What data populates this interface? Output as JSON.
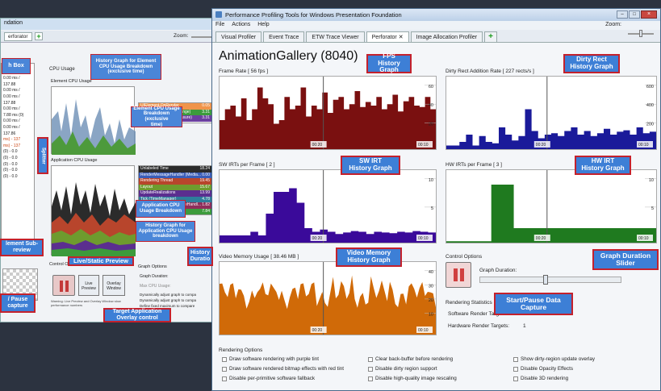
{
  "back_window": {
    "title": "ndation",
    "tab_label": "erforator",
    "zoom_label": "Zoom:",
    "cpu_usage_label": "CPU Usage",
    "element_cpu_label": "Element CPU Usage",
    "element_legend": [
      {
        "label": "UIElement.OnRender",
        "value": "0.05",
        "color": "#f0944a"
      },
      {
        "label": "UIElement Layout (Arrange)",
        "value": "3.31",
        "color": "#3c9b3c"
      },
      {
        "label": "UIElement Layout (Measure)",
        "value": "3.31",
        "color": "#6b3fa0"
      }
    ],
    "app_cpu_label": "Application CPU Usage",
    "app_legend": [
      {
        "label": "Unlabeled Time",
        "value": "18.24",
        "color": "#2b2b2b"
      },
      {
        "label": "RenderMessageHandler (Media...",
        "value": "0.00",
        "color": "#3a5db8"
      },
      {
        "label": "Rendering Thread",
        "value": "19.45",
        "color": "#b8452c"
      },
      {
        "label": "Layout",
        "value": "15.67",
        "color": "#6e9b2e"
      },
      {
        "label": "UpdateRealizations",
        "value": "13.99",
        "color": "#5b2e8f"
      },
      {
        "label": "Tick (TimeManager)",
        "value": "4.78",
        "color": "#2e7d9b"
      },
      {
        "label": "AnimatedRenderMessageHandl...",
        "value": "1.82",
        "color": "#8f2e5b"
      },
      {
        "label": "Render (MediaContext)",
        "value": "7.84",
        "color": "#3c9b3c"
      }
    ],
    "left_list": [
      "0.00 ms",
      "137.88 ms",
      "0.00 ms /",
      "137.88",
      "0.00 ms /",
      "0.00 ms /",
      "137.88",
      "0.00 ms /",
      "7.88 ms (0)",
      "0.00 ms /",
      "0.00 ms /",
      "137.86",
      "ms) - 137",
      "ms) - 137",
      "(0) - 0.0",
      "(0) - 0.0",
      "(0) - 0.0",
      "(0) - 0.0",
      "(0) - 0.0"
    ],
    "control_options": "Control Opt",
    "live_preview_btn": "Live Preview",
    "overlay_window_btn": "Overlay Window",
    "warning_text": "Warning: Live Preview and Overlay Window slow performance numbers",
    "graph_options": "Graph Options",
    "graph_duration": "Graph Duration:",
    "max_cpu": "Max CPU Usage:",
    "radio1": "Dynamically adjust graph to compa",
    "radio2": "Dynamically adjust graph to compa",
    "radio3": "Define fixed maximum to compare"
  },
  "callouts": {
    "search_box": "h Box",
    "history_graph_element": "History Graph for Element\nCPU Usage Breakdown\n(exclusive time)",
    "element_breakdown": "Element CPU Usage\nBreakdown (exclusive\ntime)",
    "splitter": "Splitter",
    "app_cpu_breakdown": "Application CPU\nUsage Breakdown",
    "history_graph_app": "History Graph for\nApplication CPU Usage\nbreakdown",
    "element_sub_preview": "lement Sub-\nreview",
    "live_static": "Live/Static Preview",
    "pause_capture": "/ Pause\ncapture",
    "history_duration": "History\nDuratio",
    "target_app": "Target Application\nOverlay control",
    "fps": "FPS\nHistory Graph",
    "dirty_rect": "Dirty Rect\nHistory Graph",
    "sw_irt": "SW IRT\nHistory Graph",
    "hw_irt": "HW IRT\nHistory Graph",
    "video_memory": "Video Memory\nHistory Graph",
    "graph_duration_slider": "Graph Duration\nSlider",
    "start_pause": "Start/Pause Data\nCapture"
  },
  "main_window": {
    "title": "Performance Profiling Tools for Windows Presentation Foundation",
    "menu": [
      "File",
      "Actions",
      "Help"
    ],
    "zoom_label": "Zoom:",
    "tabs": [
      "Visual Profiler",
      "Event Trace",
      "ETW Trace Viewer",
      "Perforator",
      "Image Allocation Profiler"
    ],
    "active_tab": "Perforator",
    "app_title": "AnimationGallery (8040)",
    "graphs": {
      "frame_rate": {
        "title": "Frame Rate [ 56 fps ]",
        "y_ticks": [
          "60",
          "40",
          "20"
        ],
        "x_ticks": [
          "00:20",
          "00:10"
        ],
        "color": "#7a1010"
      },
      "dirty_rect": {
        "title": "Dirty Rect Addition Rate [ 227 rects/s ]",
        "y_ticks": [
          "600",
          "400",
          "200"
        ],
        "x_ticks": [
          "00:20",
          "00:10"
        ],
        "color": "#1a1a9a"
      },
      "sw_irt": {
        "title": "SW IRTs per Frame [ 2 ]",
        "y_ticks": [
          "10",
          "5"
        ],
        "x_ticks": [
          "00:20",
          "00:10"
        ],
        "color": "#3a0a9a"
      },
      "hw_irt": {
        "title": "HW IRTs per Frame [ 3 ]",
        "y_ticks": [
          "10",
          "5"
        ],
        "x_ticks": [
          "00:20",
          "00:10"
        ],
        "color": "#1f7a1f"
      },
      "video_memory": {
        "title": "Video Memory Usage [ 38.46 MB ]",
        "y_ticks": [
          "40",
          "30",
          "20",
          "10"
        ],
        "x_ticks": [
          "00:20",
          "00:10"
        ],
        "color": "#d06a08"
      }
    },
    "control_options": {
      "title": "Control Options",
      "graph_duration": "Graph Duration:",
      "rendering_statistics": "Rendering Statistics",
      "software_targets_label": "Software Render Targets:",
      "software_targets_value": "0",
      "hardware_targets_label": "Hardware Render Targets:",
      "hardware_targets_value": "1"
    },
    "rendering_options": {
      "title": "Rendering Options",
      "col1": [
        "Draw software rendering with purple tint",
        "Draw software rendered bitmap effects with red tint",
        "Disable per-primitive software fallback"
      ],
      "col2": [
        "Clear back-buffer before rendering",
        "Disable dirty region support",
        "Disable high-quality image rescaling"
      ],
      "col3": [
        "Show dirty-region update overlay",
        "Disable Opacity Effects",
        "Disable 3D rendering"
      ]
    }
  }
}
